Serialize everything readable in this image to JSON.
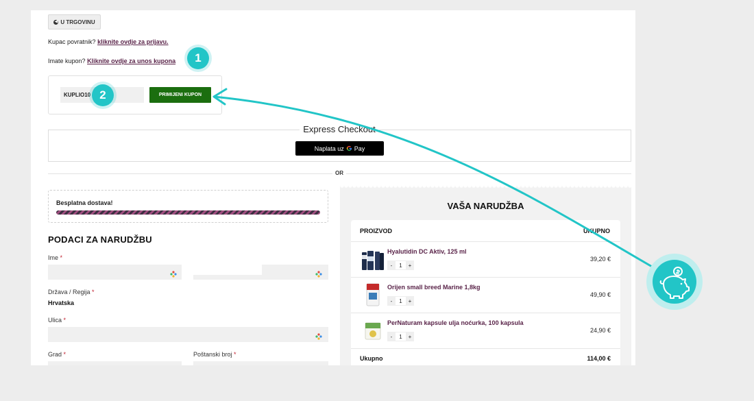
{
  "header": {
    "back_label": "U TRGOVINU"
  },
  "login": {
    "prompt": "Kupac povratnik?",
    "link": "kliknite ovdje za prijavu."
  },
  "coupon": {
    "prompt": "Imate kupon?",
    "link": "Kliknite ovdje za unos kupona",
    "code": "KUPLIO10",
    "apply_label": "PRIMIJENI KUPON"
  },
  "steps": {
    "one": "1",
    "two": "2"
  },
  "express": {
    "title": "Express Checkout",
    "gpay_prefix": "Naplata uz",
    "gpay_brand": "Pay"
  },
  "divider": {
    "or": "OR"
  },
  "shipping": {
    "label": "Besplatna dostava!",
    "progress": 1.0
  },
  "billing": {
    "title": "PODACI ZA NARUDŽBU",
    "name_label": "Ime",
    "country_label": "Država / Regija",
    "country_value": "Hrvatska",
    "street_label": "Ulica",
    "city_label": "Grad",
    "postal_label": "Poštanski broj",
    "required_mark": "*"
  },
  "order": {
    "title": "VAŠA NARUDŽBA",
    "col_product": "PROIZVOD",
    "col_total": "UKUPNO",
    "items": [
      {
        "name": "Hyalutidin DC Aktiv, 125 ml",
        "qty": "1",
        "price": "39,20 €"
      },
      {
        "name": "Orijen small breed Marine 1,8kg",
        "qty": "1",
        "price": "49,90 €"
      },
      {
        "name": "PerNaturam kapsule ulja noćurka, 100 kapsula",
        "qty": "1",
        "price": "24,90 €"
      }
    ],
    "minus": "-",
    "plus": "+",
    "total_label": "Ukupno",
    "total_value": "114,00 €"
  },
  "colors": {
    "accent": "#22c5c7",
    "apply_button": "#1b6e0f",
    "link": "#5a2449"
  },
  "icons": {
    "piggy": "piggy-bank-coin-icon",
    "back": "arrow-left-circle-icon",
    "autofill": "autofill-icon"
  }
}
